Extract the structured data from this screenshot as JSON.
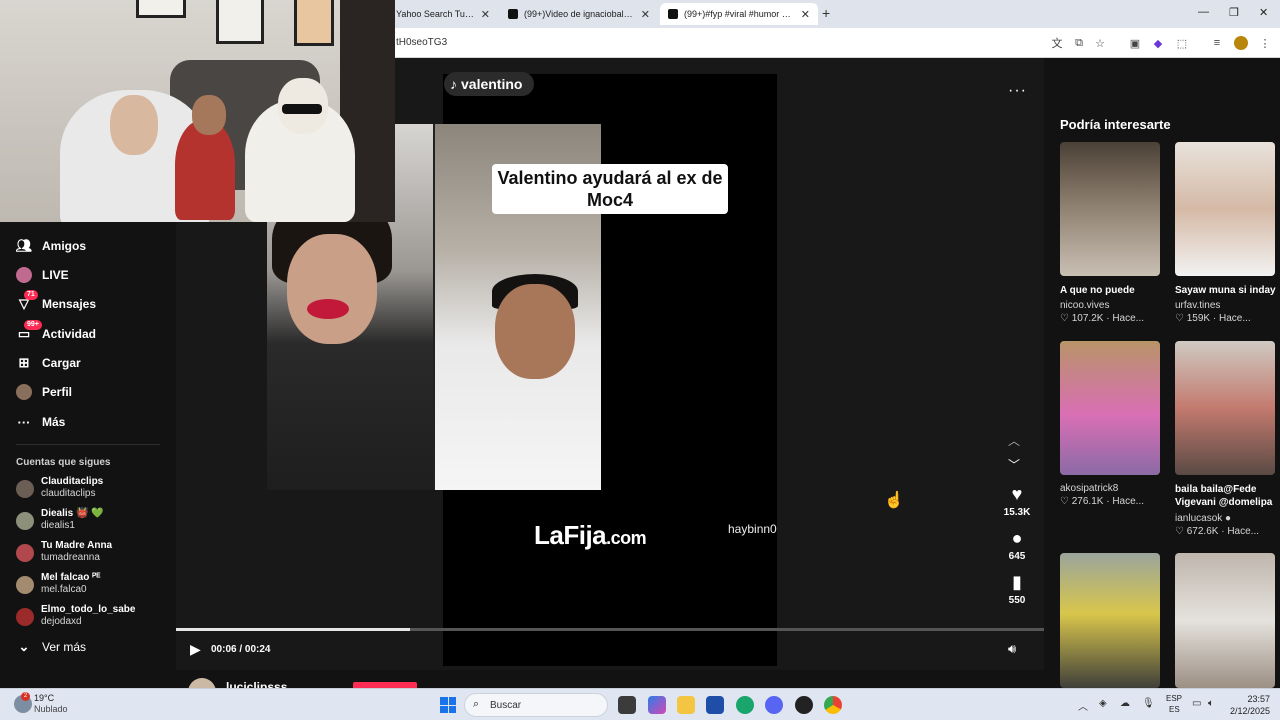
{
  "browser": {
    "tabs": [
      {
        "label": "Yahoo Search Tus resultados"
      },
      {
        "label": "(99+)Video de ignaciobaladan2"
      },
      {
        "label": "(99+)#fyp #viral #humor #valentino"
      }
    ],
    "url_fragment": "tH0seoTG3"
  },
  "sidebar": {
    "nav": [
      {
        "label": "Amigos",
        "icon": "friends-icon"
      },
      {
        "label": "LIVE",
        "icon": "live-icon"
      },
      {
        "label": "Mensajes",
        "icon": "messages-icon",
        "badge": "71"
      },
      {
        "label": "Actividad",
        "icon": "activity-icon",
        "badge": "99+"
      },
      {
        "label": "Cargar",
        "icon": "upload-icon"
      },
      {
        "label": "Perfil",
        "icon": "profile-icon"
      },
      {
        "label": "Más",
        "icon": "more-icon"
      }
    ],
    "following_title": "Cuentas que sigues",
    "following": [
      {
        "name": "Clauditaclips",
        "handle": "clauditaclips"
      },
      {
        "name": "Diealis 👹 💚",
        "handle": "diealis1"
      },
      {
        "name": "Tu Madre Anna",
        "handle": "tumadreanna"
      },
      {
        "name": "Mel falcao ᴾᴱ",
        "handle": "mel.falca0"
      },
      {
        "name": "Elmo_todo_lo_sabe",
        "handle": "dejodaxd"
      }
    ],
    "see_more": "Ver más"
  },
  "video": {
    "author_pill": "valentino",
    "caption": "Valentino ayudará al ex de Moc4",
    "watermark_main": "LaFija",
    "watermark_suffix": ".com",
    "corner_tag": "haybinn0",
    "likes": "15.3K",
    "comments": "645",
    "saves": "550",
    "time": "00:06 / 00:24",
    "progress": 0.27,
    "bottom_author": "luciclipsss"
  },
  "recommendations": {
    "title": "Podría interesarte",
    "items": [
      {
        "title": "A que no puede",
        "author": "nicoo.vives",
        "stats": "♡ 107.2K · Hace..."
      },
      {
        "title": "Sayaw muna si inday",
        "author": "urfav.tines",
        "stats": "♡ 159K · Hace..."
      },
      {
        "title": "",
        "author": "akosipatrick8",
        "stats": "♡ 276.1K · Hace..."
      },
      {
        "title": "baila baila@Fede Vigevani @domelipa",
        "author": "ianlucasok ●",
        "stats": "♡ 672.6K · Hace..."
      }
    ]
  },
  "taskbar": {
    "temp": "19°C",
    "condition": "Nublado",
    "weather_badge": "2",
    "search_label": "Buscar",
    "lang_top": "ESP",
    "lang_bottom": "ES",
    "time": "23:57",
    "date": "2/12/2025"
  }
}
